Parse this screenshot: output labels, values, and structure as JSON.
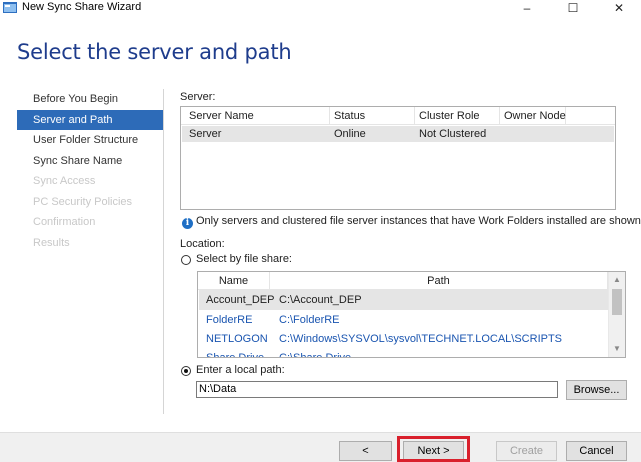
{
  "window": {
    "title": "New Sync Share Wizard",
    "minimize": "–",
    "maximize": "☐",
    "close": "✕"
  },
  "page_title": "Select the server and path",
  "nav": {
    "items": [
      {
        "label": "Before You Begin",
        "state": "normal"
      },
      {
        "label": "Server and Path",
        "state": "active"
      },
      {
        "label": "User Folder Structure",
        "state": "normal"
      },
      {
        "label": "Sync Share Name",
        "state": "normal"
      },
      {
        "label": "Sync Access",
        "state": "disabled"
      },
      {
        "label": "PC Security Policies",
        "state": "disabled"
      },
      {
        "label": "Confirmation",
        "state": "disabled"
      },
      {
        "label": "Results",
        "state": "disabled"
      }
    ]
  },
  "server": {
    "label": "Server:",
    "columns": [
      "Server Name",
      "Status",
      "Cluster Role",
      "Owner Node"
    ],
    "rows": [
      {
        "name": "Server",
        "status": "Online",
        "cluster_role": "Not Clustered",
        "owner_node": ""
      }
    ],
    "info_text": "Only servers and clustered file server instances that have Work Folders installed are shown."
  },
  "location": {
    "label": "Location:",
    "file_share_option": "Select by file share:",
    "file_share_selected": false,
    "share_columns": [
      "Name",
      "Path"
    ],
    "shares": [
      {
        "name": "Account_DEP",
        "path": "C:\\Account_DEP"
      },
      {
        "name": "FolderRE",
        "path": "C:\\FolderRE"
      },
      {
        "name": "NETLOGON",
        "path": "C:\\Windows\\SYSVOL\\sysvol\\TECHNET.LOCAL\\SCRIPTS"
      },
      {
        "name": "Share Drive",
        "path": "C:\\Share Drive"
      }
    ],
    "local_path_option": "Enter a local path:",
    "local_path_selected": true,
    "local_path_value": "N:\\Data",
    "browse_label": "Browse..."
  },
  "footer": {
    "previous_label": "< Previous",
    "next_label": "Next >",
    "create_label": "Create",
    "cancel_label": "Cancel"
  },
  "colors": {
    "accent": "#2d6bb8",
    "heading": "#1e3c8c",
    "highlight": "#d9202c",
    "link": "#1a55b0"
  }
}
